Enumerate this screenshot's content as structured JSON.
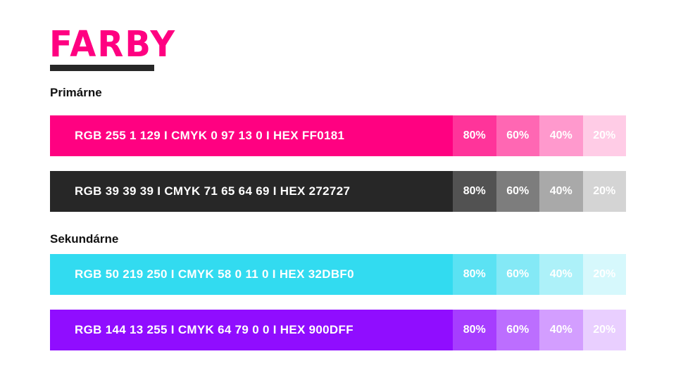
{
  "title": "FARBY",
  "sections": {
    "primary": "Primárne",
    "secondary": "Sekundárne"
  },
  "swatches": [
    {
      "label": "RGB 255 1 129 I CMYK 0 97 13 0 I HEX FF0181",
      "color": "#FF0181",
      "tints": [
        {
          "label": "80%",
          "color": "#FF349A"
        },
        {
          "label": "60%",
          "color": "#FF67B3"
        },
        {
          "label": "40%",
          "color": "#FF99CD"
        },
        {
          "label": "20%",
          "color": "#FFCCE6"
        }
      ]
    },
    {
      "label": "RGB 39 39 39 I CMYK 71 65 64 69 I HEX 272727",
      "color": "#272727",
      "tints": [
        {
          "label": "80%",
          "color": "#525252"
        },
        {
          "label": "60%",
          "color": "#7D7D7D"
        },
        {
          "label": "40%",
          "color": "#A9A9A9"
        },
        {
          "label": "20%",
          "color": "#D4D4D4"
        }
      ]
    },
    {
      "label": "RGB 50 219 250 I CMYK 58 0 11 0 I HEX 32DBF0",
      "color": "#32DBF0",
      "tints": [
        {
          "label": "80%",
          "color": "#5BE2F3"
        },
        {
          "label": "60%",
          "color": "#84E9F6"
        },
        {
          "label": "40%",
          "color": "#ADF1F9"
        },
        {
          "label": "20%",
          "color": "#D6F8FC"
        }
      ]
    },
    {
      "label": "RGB 144 13 255 I CMYK 64 79 0 0 I HEX 900DFF",
      "color": "#900DFF",
      "tints": [
        {
          "label": "80%",
          "color": "#A63DFF"
        },
        {
          "label": "60%",
          "color": "#BC6EFF"
        },
        {
          "label": "40%",
          "color": "#D39EFF"
        },
        {
          "label": "20%",
          "color": "#E9CFFF"
        }
      ]
    }
  ]
}
